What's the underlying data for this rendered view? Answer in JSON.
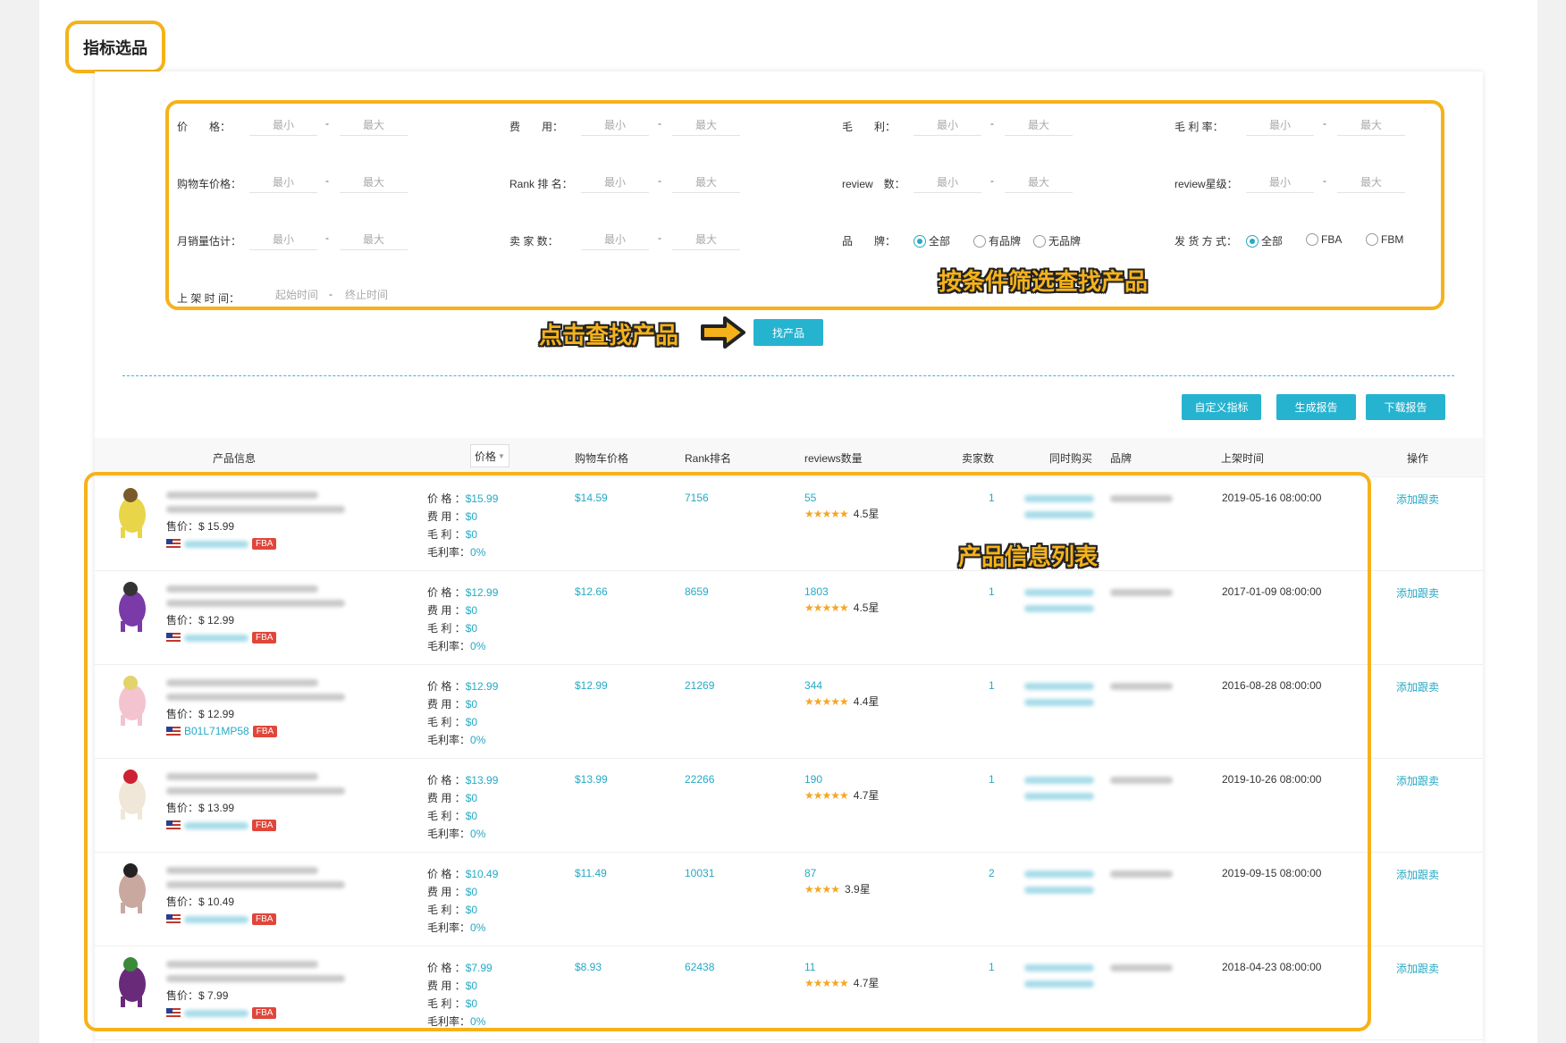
{
  "page_title": "指标选品",
  "filters": {
    "row1": [
      {
        "label": "价　　格：",
        "min": "最小",
        "max": "最大"
      },
      {
        "label": "费　　用：",
        "min": "最小",
        "max": "最大"
      },
      {
        "label": "毛　　利：",
        "min": "最小",
        "max": "最大"
      },
      {
        "label": "毛 利 率：",
        "min": "最小",
        "max": "最大"
      }
    ],
    "row2": [
      {
        "label": "购物车价格：",
        "min": "最小",
        "max": "最大"
      },
      {
        "label": "Rank 排 名：",
        "min": "最小",
        "max": "最大"
      },
      {
        "label": "review　数：",
        "min": "最小",
        "max": "最大"
      },
      {
        "label": "review星级：",
        "min": "最小",
        "max": "最大"
      }
    ],
    "row3": [
      {
        "label": "月销量估计：",
        "min": "最小",
        "max": "最大"
      },
      {
        "label": "卖 家 数：",
        "min": "最小",
        "max": "最大"
      }
    ],
    "brand": {
      "label": "品　　牌：",
      "options": [
        "全部",
        "有品牌",
        "无品牌"
      ],
      "selected": "全部"
    },
    "shipping": {
      "label": "发 货 方 式：",
      "options": [
        "全部",
        "FBA",
        "FBM"
      ],
      "selected": "全部"
    },
    "listing_time": {
      "label": "上 架 时 间：",
      "start": "起始时间",
      "end": "终止时间"
    },
    "dash": "-"
  },
  "callouts": {
    "filter": "按条件筛选查找产品",
    "click": "点击查找产品",
    "list": "产品信息列表"
  },
  "find_button": "找产品",
  "toolbar": {
    "custom": "自定义指标",
    "generate": "生成报告",
    "download": "下载报告"
  },
  "table": {
    "headers": {
      "product": "产品信息",
      "price": "价格",
      "cart_price": "购物车价格",
      "rank": "Rank排名",
      "reviews": "reviews数量",
      "sellers": "卖家数",
      "also_bought": "同时购买",
      "brand": "品牌",
      "listed": "上架时间",
      "action": "操作"
    },
    "line_labels": {
      "price": "价 格",
      "fee": "费 用",
      "profit": "毛 利",
      "margin": "毛利率"
    },
    "sale_label": "售价：",
    "fba": "FBA",
    "action_label": "添加跟卖",
    "rows": [
      {
        "sale_price": "$ 15.99",
        "asin": "",
        "price": "$15.99",
        "fee": "$0",
        "profit": "$0",
        "margin": "0%",
        "cart_price": "$14.59",
        "rank": "7156",
        "reviews": "55",
        "stars": "★★★★★",
        "rating": "4.5星",
        "sellers": "1",
        "listed": "2019-05-16 08:00:00"
      },
      {
        "sale_price": "$ 12.99",
        "asin": "",
        "price": "$12.99",
        "fee": "$0",
        "profit": "$0",
        "margin": "0%",
        "cart_price": "$12.66",
        "rank": "8659",
        "reviews": "1803",
        "stars": "★★★★★",
        "rating": "4.5星",
        "sellers": "1",
        "listed": "2017-01-09 08:00:00"
      },
      {
        "sale_price": "$ 12.99",
        "asin": "B01L71MP58",
        "price": "$12.99",
        "fee": "$0",
        "profit": "$0",
        "margin": "0%",
        "cart_price": "$12.99",
        "rank": "21269",
        "reviews": "344",
        "stars": "★★★★★",
        "rating": "4.4星",
        "sellers": "1",
        "listed": "2016-08-28 08:00:00"
      },
      {
        "sale_price": "$ 13.99",
        "asin": "",
        "price": "$13.99",
        "fee": "$0",
        "profit": "$0",
        "margin": "0%",
        "cart_price": "$13.99",
        "rank": "22266",
        "reviews": "190",
        "stars": "★★★★★",
        "rating": "4.7星",
        "sellers": "1",
        "listed": "2019-10-26 08:00:00"
      },
      {
        "sale_price": "$ 10.49",
        "asin": "",
        "price": "$10.49",
        "fee": "$0",
        "profit": "$0",
        "margin": "0%",
        "cart_price": "$11.49",
        "rank": "10031",
        "reviews": "87",
        "stars": "★★★★",
        "rating": "3.9星",
        "sellers": "2",
        "listed": "2019-09-15 08:00:00"
      },
      {
        "sale_price": "$ 7.99",
        "asin": "",
        "price": "$7.99",
        "fee": "$0",
        "profit": "$0",
        "margin": "0%",
        "cart_price": "$8.93",
        "rank": "62438",
        "reviews": "11",
        "stars": "★★★★★",
        "rating": "4.7星",
        "sellers": "1",
        "listed": "2018-04-23 08:00:00"
      }
    ]
  },
  "colors": {
    "accent": "#26b3d0",
    "highlight": "#f5b21a",
    "fba": "#e0463a",
    "star": "#f5a623"
  }
}
